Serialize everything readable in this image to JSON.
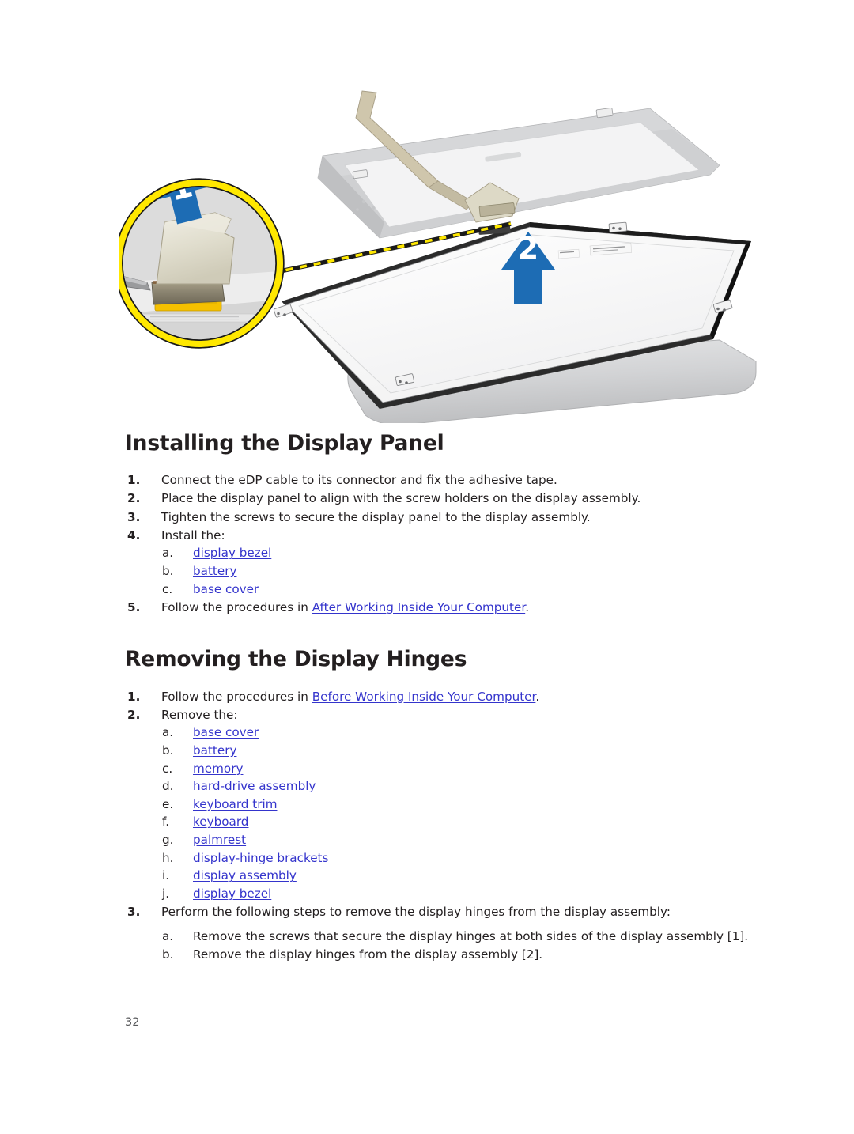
{
  "document": {
    "page_number": "32",
    "link_color": "#3434cc",
    "text_color": "#231f20"
  },
  "figure": {
    "caption_absent": true,
    "callout_labels": [
      "1",
      "2"
    ],
    "arrow_color": "#1d6cb4",
    "magnifier_ring_color": "#ffe800",
    "leader_line_colors": [
      "#ffe800",
      "#111111"
    ],
    "panel_color": "#f2f2f2",
    "chassis_color": "#c9cacb",
    "alt_text": "Laptop display assembly with magnified callout showing the eDP cable connector and adhesive tape being lifted [1], and the display panel being lifted away from the display assembly [2]."
  },
  "sections": [
    {
      "id": "installing-display-panel",
      "title": "Installing the Display Panel",
      "steps": [
        {
          "num": "1.",
          "text": "Connect the eDP cable to its connector and fix the adhesive tape."
        },
        {
          "num": "2.",
          "text": "Place the display panel to align with the screw holders on the display assembly."
        },
        {
          "num": "3.",
          "text": "Tighten the screws to secure the display panel to the display assembly."
        },
        {
          "num": "4.",
          "text": "Install the:",
          "substeps": [
            {
              "let": "a.",
              "text": "display bezel",
              "link": true
            },
            {
              "let": "b.",
              "text": "battery",
              "link": true
            },
            {
              "let": "c.",
              "text": "base cover",
              "link": true
            }
          ]
        },
        {
          "num": "5.",
          "text_before": "Follow the procedures in ",
          "link_text": "After Working Inside Your Computer",
          "text_after": "."
        }
      ]
    },
    {
      "id": "removing-display-hinges",
      "title": "Removing the Display Hinges",
      "steps": [
        {
          "num": "1.",
          "text_before": "Follow the procedures in ",
          "link_text": "Before Working Inside Your Computer",
          "text_after": "."
        },
        {
          "num": "2.",
          "text": "Remove the:",
          "substeps": [
            {
              "let": "a.",
              "text": "base cover",
              "link": true
            },
            {
              "let": "b.",
              "text": "battery",
              "link": true
            },
            {
              "let": "c.",
              "text": "memory",
              "link": true
            },
            {
              "let": "d.",
              "text": "hard-drive assembly",
              "link": true
            },
            {
              "let": "e.",
              "text": "keyboard trim",
              "link": true
            },
            {
              "let": "f.",
              "text": "keyboard",
              "link": true
            },
            {
              "let": "g.",
              "text": "palmrest",
              "link": true
            },
            {
              "let": "h.",
              "text": "display-hinge brackets",
              "link": true
            },
            {
              "let": "i.",
              "text": "display assembly",
              "link": true
            },
            {
              "let": "j.",
              "text": "display bezel",
              "link": true
            }
          ]
        },
        {
          "num": "3.",
          "text": "Perform the following steps to remove the display hinges from the display assembly:",
          "substeps": [
            {
              "let": "a.",
              "text": "Remove the screws that secure the display hinges at both sides of the display assembly [1].",
              "link": false
            },
            {
              "let": "b.",
              "text": "Remove the display hinges from the display assembly [2].",
              "link": false
            }
          ]
        }
      ]
    }
  ]
}
